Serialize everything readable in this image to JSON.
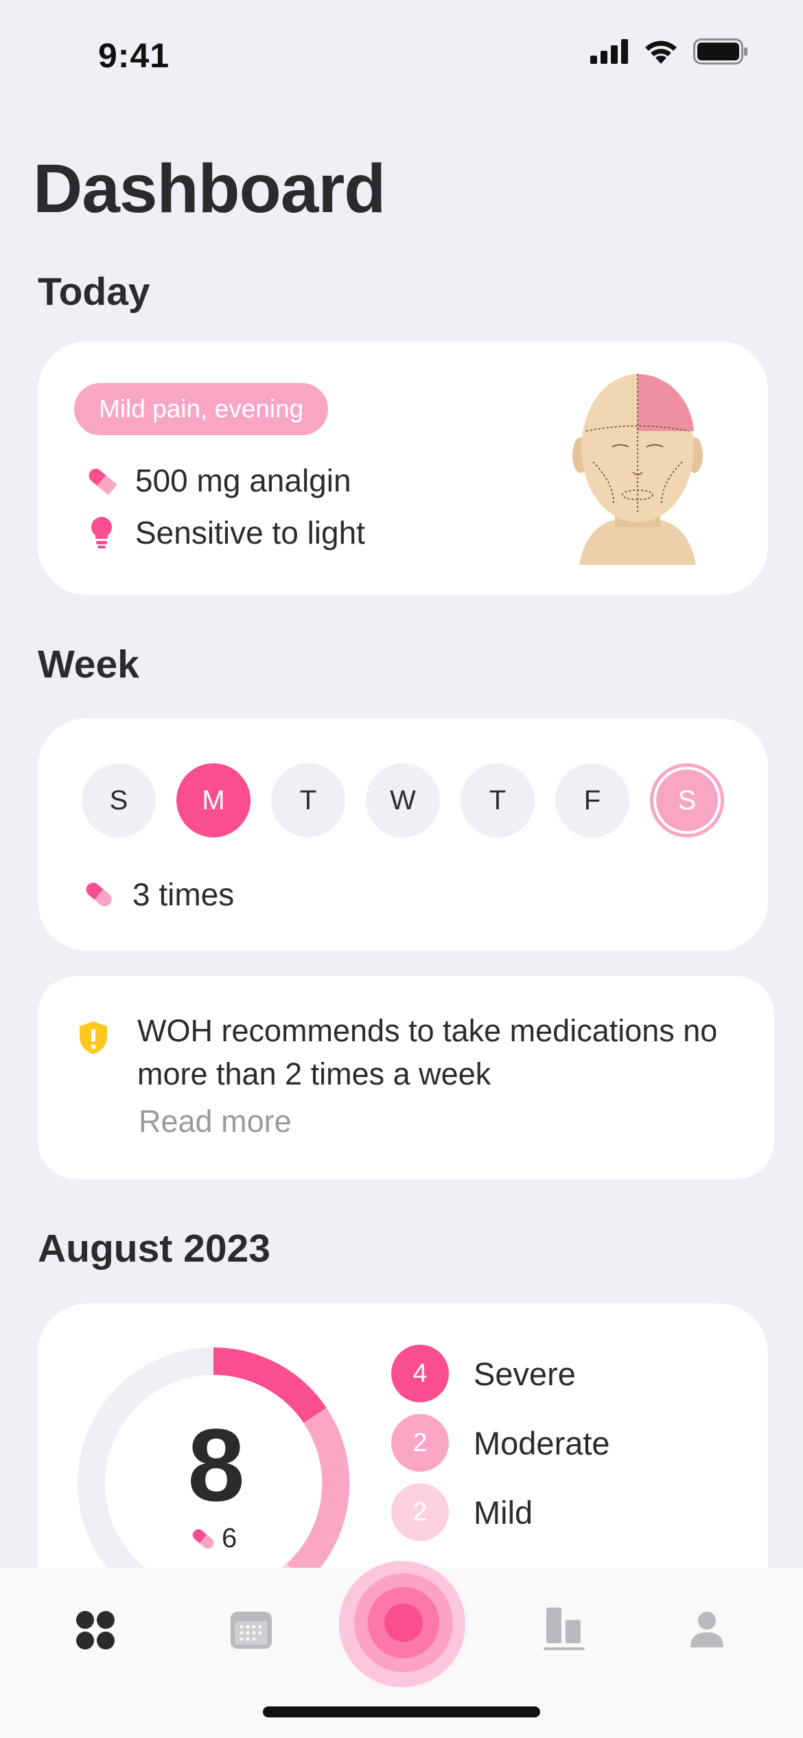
{
  "status": {
    "time": "9:41"
  },
  "page": {
    "title": "Dashboard"
  },
  "today": {
    "section_title": "Today",
    "badge": "Mild pain, evening",
    "medication": "500 mg analgin",
    "symptom": "Sensitive to light"
  },
  "week": {
    "section_title": "Week",
    "days": [
      "S",
      "M",
      "T",
      "W",
      "T",
      "F",
      "S"
    ],
    "active_day_index": 1,
    "current_day_index": 6,
    "medication_count": "3 times"
  },
  "notice": {
    "text": "WOH recommends to take medications no more than 2 times a week",
    "link": "Read more"
  },
  "month": {
    "section_title": "August 2023",
    "total": "8",
    "medications": "6",
    "legend": [
      {
        "count": "4",
        "label": "Severe",
        "color": "#fb4e90"
      },
      {
        "count": "2",
        "label": "Moderate",
        "color": "#fca6c6"
      },
      {
        "count": "2",
        "label": "Mild",
        "color": "#fdd0e0"
      }
    ]
  },
  "colors": {
    "accent": "#fb4e90",
    "accent_light": "#f9a5c4",
    "background": "#f0eff6"
  },
  "icons": [
    "pill-icon",
    "lightbulb-icon",
    "shield-warning-icon",
    "dashboard-icon",
    "calendar-icon",
    "record-pain-icon",
    "statistics-icon",
    "profile-icon"
  ]
}
